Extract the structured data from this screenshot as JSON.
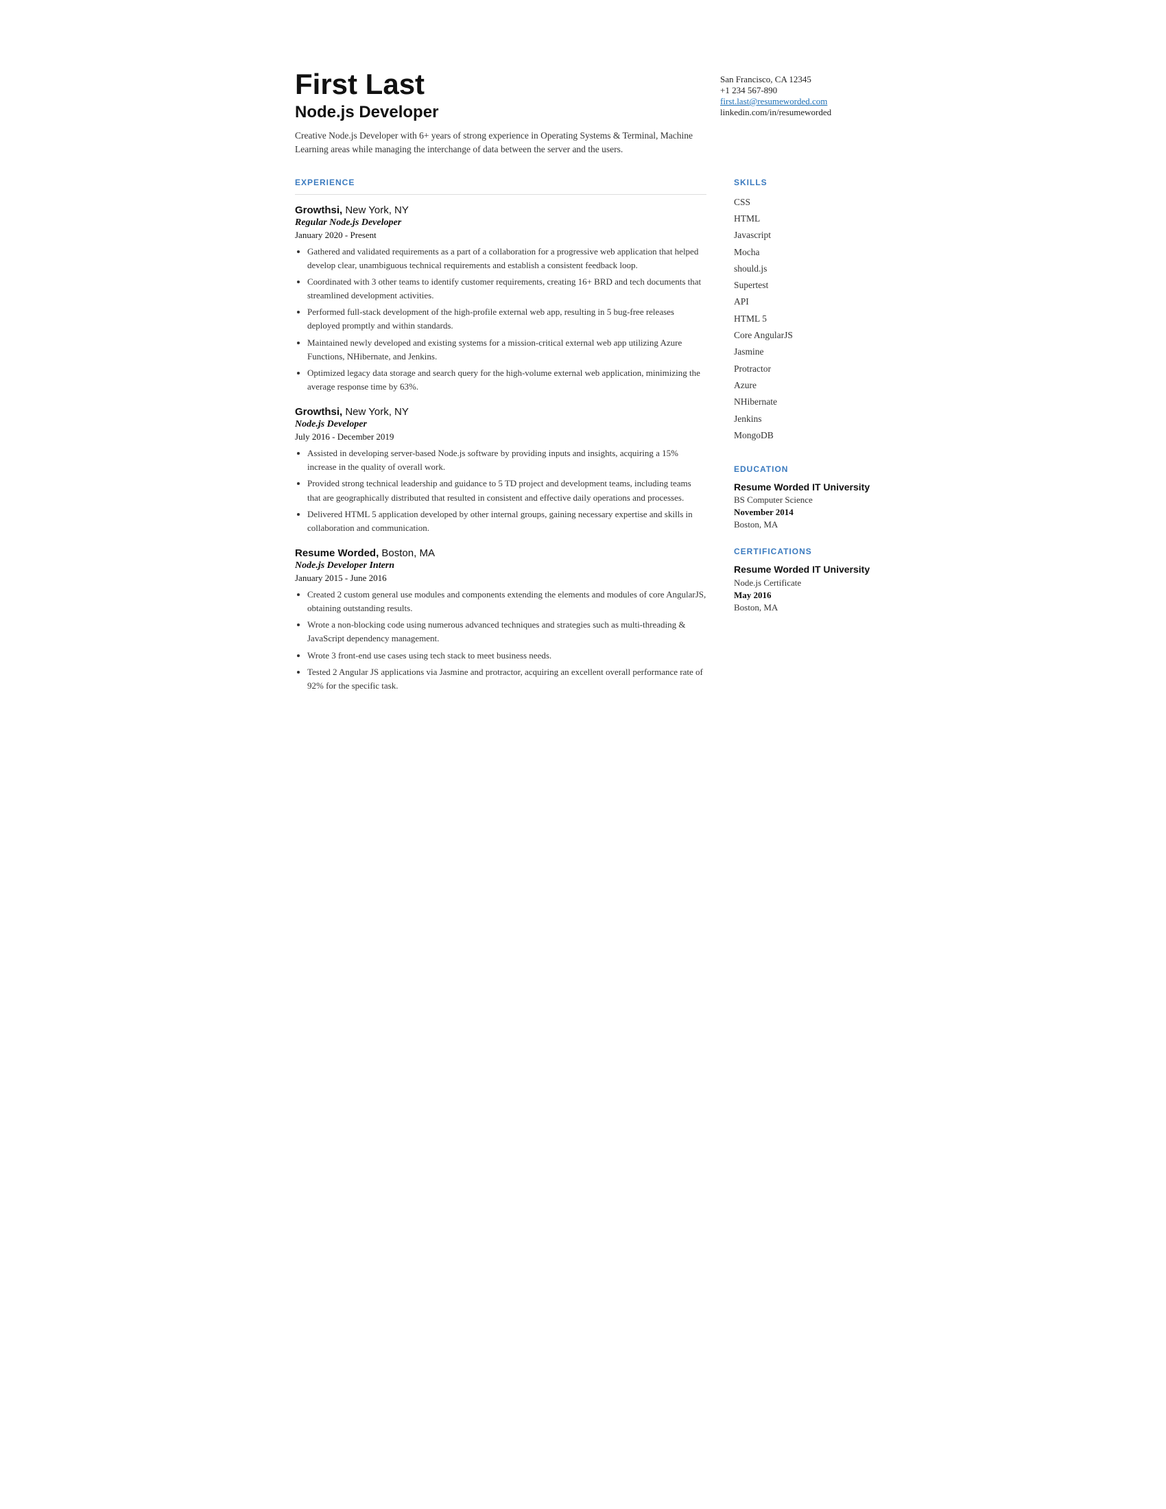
{
  "header": {
    "name": "First Last",
    "title": "Node.js Developer",
    "summary": "Creative Node.js Developer with 6+ years of strong experience in Operating Systems & Terminal, Machine Learning areas while managing the interchange of data between the server and the users.",
    "contact": {
      "address": "San Francisco, CA 12345",
      "phone": "+1 234 567-890",
      "email": "first.last@resumeworded.com",
      "linkedin": "linkedin.com/in/resumeworded"
    }
  },
  "sections": {
    "experience_label": "EXPERIENCE",
    "skills_label": "SKILLS",
    "education_label": "EDUCATION",
    "certifications_label": "CERTIFICATIONS"
  },
  "experience": [
    {
      "company": "Growthsi,",
      "location": " New York, NY",
      "job_title": "Regular Node.js Developer",
      "dates": "January 2020 - Present",
      "bullets": [
        "Gathered and validated requirements as a part of a collaboration for a progressive web application that helped develop clear, unambiguous technical requirements and establish a consistent feedback loop.",
        "Coordinated with 3 other teams to identify customer requirements, creating 16+ BRD and tech documents that streamlined development activities.",
        "Performed full-stack development of the high-profile external web app, resulting in 5 bug-free releases deployed promptly and within standards.",
        "Maintained newly developed and existing systems for a mission-critical external web app utilizing Azure Functions, NHibernate, and Jenkins.",
        "Optimized legacy data storage and search query for the high-volume external web application, minimizing the average response time by 63%."
      ]
    },
    {
      "company": "Growthsi,",
      "location": " New York, NY",
      "job_title": "Node.js Developer",
      "dates": "July 2016 - December 2019",
      "bullets": [
        "Assisted in developing server-based Node.js software by providing inputs and insights, acquiring a 15% increase in the quality of overall work.",
        "Provided strong technical leadership and guidance to 5 TD project and development teams, including teams that are geographically distributed that resulted in consistent and effective daily operations and processes.",
        "Delivered HTML 5 application developed by other internal groups, gaining necessary expertise and skills in collaboration and communication."
      ]
    },
    {
      "company": "Resume Worded,",
      "location": " Boston, MA",
      "job_title": "Node.js Developer Intern",
      "dates": "January 2015 - June 2016",
      "bullets": [
        "Created 2 custom general use modules and components extending the elements and modules of core AngularJS, obtaining outstanding results.",
        "Wrote a non-blocking code using numerous advanced techniques and strategies such as multi-threading & JavaScript dependency management.",
        "Wrote 3 front-end use cases using tech stack to meet business needs.",
        "Tested 2 Angular JS applications via Jasmine and protractor, acquiring an excellent overall performance rate of 92% for the specific task."
      ]
    }
  ],
  "skills": [
    "CSS",
    "HTML",
    "Javascript",
    "Mocha",
    "should.js",
    "Supertest",
    "API",
    "HTML 5",
    "Core AngularJS",
    "Jasmine",
    "Protractor",
    "Azure",
    "NHibernate",
    "Jenkins",
    "MongoDB"
  ],
  "education": [
    {
      "institution": "Resume Worded IT University",
      "degree": "BS Computer Science",
      "date": "November 2014",
      "location": "Boston, MA"
    }
  ],
  "certifications": [
    {
      "institution": "Resume Worded IT University",
      "degree": "Node.js Certificate",
      "date": "May 2016",
      "location": "Boston, MA"
    }
  ]
}
